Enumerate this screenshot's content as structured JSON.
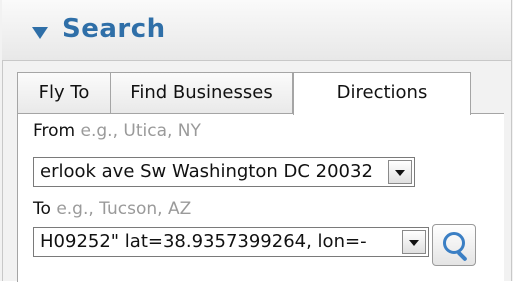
{
  "header": {
    "title": "Search",
    "collapse_icon": "triangle-down-icon"
  },
  "tabs": [
    {
      "label": "Fly To"
    },
    {
      "label": "Find Businesses"
    },
    {
      "label": "Directions",
      "active": true
    }
  ],
  "from": {
    "label": "From",
    "hint": "e.g., Utica, NY",
    "value": "erlook ave Sw Washington DC 20032"
  },
  "to": {
    "label": "To",
    "hint": "e.g., Tucson, AZ",
    "value": "H09252\" lat=38.9357399264, lon=-"
  },
  "search_button": {
    "icon": "magnifier-icon"
  },
  "colors": {
    "accent": "#2f6fa8",
    "icon": "#3b7fc4",
    "hint": "#9a9a9a"
  }
}
